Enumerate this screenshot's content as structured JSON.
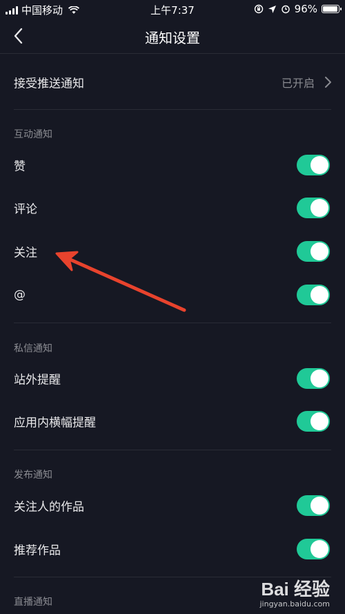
{
  "status_bar": {
    "carrier": "中国移动",
    "time": "上午7:37",
    "battery": "96%",
    "battery_level": 0.96
  },
  "nav": {
    "title": "通知设置",
    "back_icon": "chevron-left-icon"
  },
  "push": {
    "label": "接受推送通知",
    "value": "已开启"
  },
  "sections": {
    "interaction": {
      "title": "互动通知",
      "items": [
        {
          "label": "赞",
          "enabled": true
        },
        {
          "label": "评论",
          "enabled": true
        },
        {
          "label": "关注",
          "enabled": true
        },
        {
          "label": "@",
          "enabled": true
        }
      ]
    },
    "message": {
      "title": "私信通知",
      "items": [
        {
          "label": "站外提醒",
          "enabled": true
        },
        {
          "label": "应用内横幅提醒",
          "enabled": true
        }
      ]
    },
    "publish": {
      "title": "发布通知",
      "items": [
        {
          "label": "关注人的作品",
          "enabled": true
        },
        {
          "label": "推荐作品",
          "enabled": true
        }
      ]
    },
    "live": {
      "title": "直播通知"
    }
  },
  "colors": {
    "background": "#161823",
    "toggle_on": "#20c997",
    "annotation_arrow": "#e8432d"
  },
  "watermark": {
    "logo": "Bai 经验",
    "url": "jingyan.baidu.com"
  }
}
